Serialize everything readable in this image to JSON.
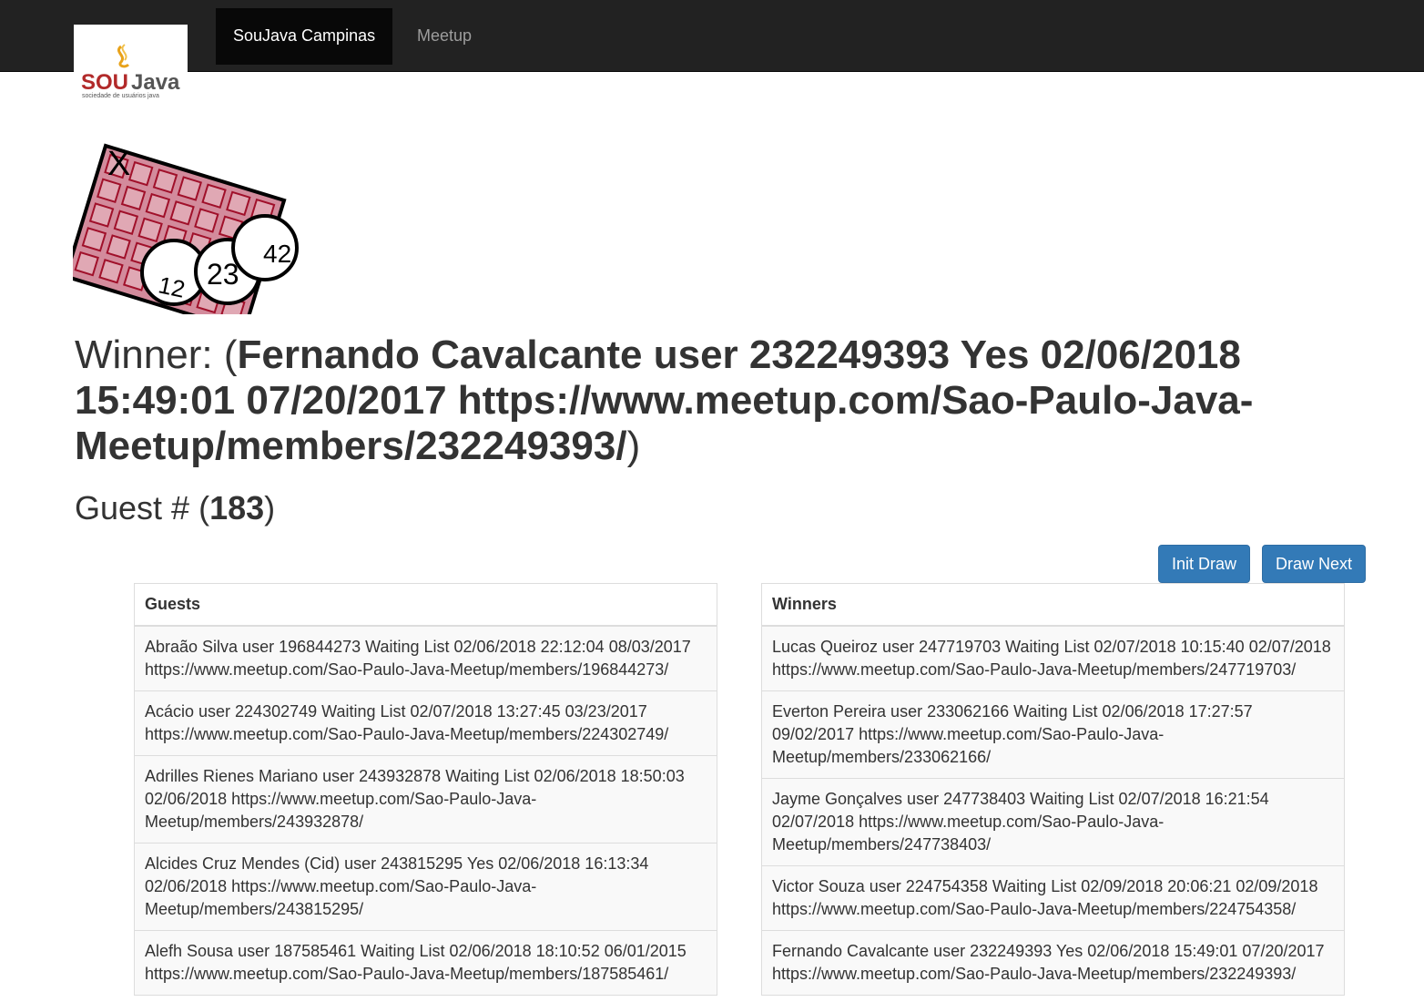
{
  "nav": {
    "logo_text": "SOUJava",
    "logo_tagline": "sociedade de usuários java",
    "items": [
      {
        "label": "SouJava Campinas"
      },
      {
        "label": "Meetup"
      }
    ]
  },
  "bingo_card": {
    "mark": "X",
    "balls": [
      "12",
      "23",
      "42"
    ]
  },
  "winner": {
    "prefix": "Winner: (",
    "value": "Fernando Cavalcante user 232249393 Yes 02/06/2018 15:49:01 07/20/2017 https://www.meetup.com/Sao-Paulo-Java-Meetup/members/232249393/",
    "suffix": ")"
  },
  "guest_count": {
    "prefix": "Guest # (",
    "value": "183",
    "suffix": ")"
  },
  "buttons": {
    "init_draw": "Init Draw",
    "draw_next": "Draw Next"
  },
  "guests": {
    "title": "Guests",
    "rows": [
      "Abraão Silva user 196844273 Waiting List 02/06/2018 22:12:04 08/03/2017 https://www.meetup.com/Sao-Paulo-Java-Meetup/members/196844273/",
      "Acácio user 224302749 Waiting List 02/07/2018 13:27:45 03/23/2017 https://www.meetup.com/Sao-Paulo-Java-Meetup/members/224302749/",
      "Adrilles Rienes Mariano user 243932878 Waiting List 02/06/2018 18:50:03 02/06/2018 https://www.meetup.com/Sao-Paulo-Java-Meetup/members/243932878/",
      "Alcides Cruz Mendes (Cid) user 243815295 Yes 02/06/2018 16:13:34 02/06/2018 https://www.meetup.com/Sao-Paulo-Java-Meetup/members/243815295/",
      "Alefh Sousa user 187585461 Waiting List 02/06/2018 18:10:52 06/01/2015 https://www.meetup.com/Sao-Paulo-Java-Meetup/members/187585461/"
    ]
  },
  "winners": {
    "title": "Winners",
    "rows": [
      "Lucas Queiroz user 247719703 Waiting List 02/07/2018 10:15:40 02/07/2018 https://www.meetup.com/Sao-Paulo-Java-Meetup/members/247719703/",
      "Everton Pereira user 233062166 Waiting List 02/06/2018 17:27:57 09/02/2017 https://www.meetup.com/Sao-Paulo-Java-Meetup/members/233062166/",
      "Jayme Gonçalves user 247738403 Waiting List 02/07/2018 16:21:54 02/07/2018 https://www.meetup.com/Sao-Paulo-Java-Meetup/members/247738403/",
      "Victor Souza user 224754358 Waiting List 02/09/2018 20:06:21 02/09/2018 https://www.meetup.com/Sao-Paulo-Java-Meetup/members/224754358/",
      "Fernando Cavalcante user 232249393 Yes 02/06/2018 15:49:01 07/20/2017 https://www.meetup.com/Sao-Paulo-Java-Meetup/members/232249393/"
    ]
  }
}
